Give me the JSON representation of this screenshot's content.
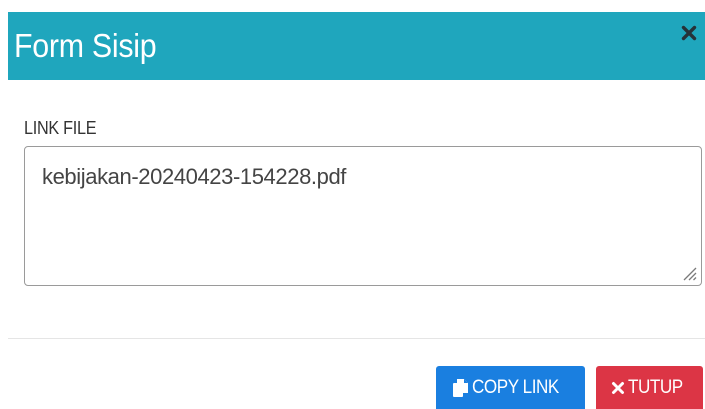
{
  "modal": {
    "title": "Form Sisip",
    "close_icon": "close-icon"
  },
  "form": {
    "label": "LINK FILE",
    "value": "kebijakan-20240423-154228.pdf"
  },
  "footer": {
    "copy_label": "COPY LINK",
    "copy_icon": "copy-icon",
    "close_label": "TUTUP",
    "close_icon": "times-icon"
  },
  "colors": {
    "header": "#1fa6bd",
    "copy_button": "#1a7fe0",
    "close_button": "#dc3545"
  }
}
